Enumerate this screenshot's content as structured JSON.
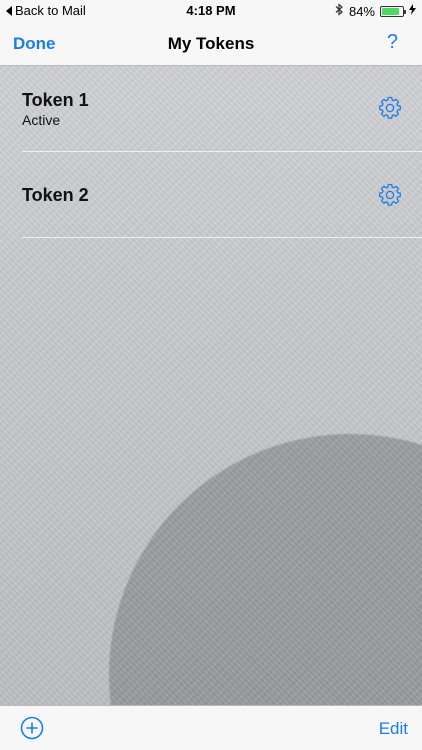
{
  "status_bar": {
    "back_label": "Back to Mail",
    "time": "4:18 PM",
    "battery_percent": "84%",
    "battery_level": 0.84,
    "icons": [
      "bluetooth-icon",
      "battery-icon",
      "charging-icon"
    ]
  },
  "nav": {
    "done_label": "Done",
    "title": "My Tokens",
    "help_label": "?"
  },
  "tokens": [
    {
      "name": "Token 1",
      "status": "Active"
    },
    {
      "name": "Token 2",
      "status": ""
    }
  ],
  "toolbar": {
    "add_icon": "add-circle-icon",
    "edit_label": "Edit"
  },
  "colors": {
    "accent": "#1a7ee6",
    "battery": "#4cd964",
    "bar_background": "#f7f7f7"
  }
}
